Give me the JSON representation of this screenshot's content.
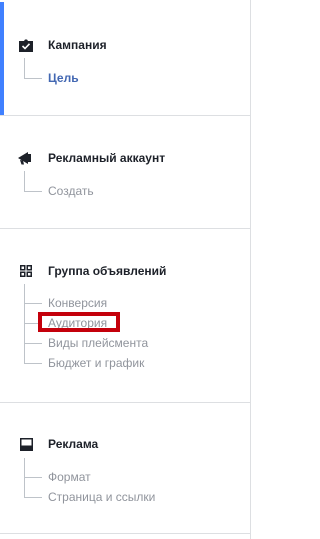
{
  "sections": [
    {
      "title": "Кампания",
      "icon": "briefcase-check-icon",
      "items": [
        {
          "label": "Цель",
          "active": true
        }
      ]
    },
    {
      "title": "Рекламный аккаунт",
      "icon": "megaphone-icon",
      "items": [
        {
          "label": "Создать",
          "active": false
        }
      ]
    },
    {
      "title": "Группа объявлений",
      "icon": "grid-icon",
      "items": [
        {
          "label": "Конверсия",
          "active": false
        },
        {
          "label": "Аудитория",
          "active": false
        },
        {
          "label": "Виды плейсмента",
          "active": false
        },
        {
          "label": "Бюджет и график",
          "active": false
        }
      ]
    },
    {
      "title": "Реклама",
      "icon": "ad-layout-icon",
      "items": [
        {
          "label": "Формат",
          "active": false
        },
        {
          "label": "Страница и ссылки",
          "active": false
        }
      ]
    }
  ],
  "colors": {
    "accent": "#4080ff",
    "active_text": "#4267b2",
    "highlight": "#c4000b"
  }
}
